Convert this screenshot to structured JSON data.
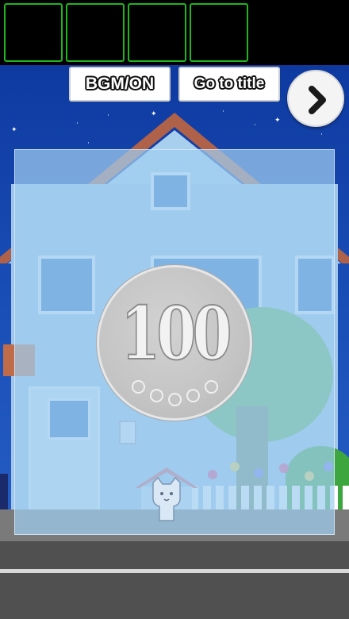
{
  "inventory": {
    "slots": [
      "",
      "",
      "",
      ""
    ],
    "slot_border_color": "#1fb51f"
  },
  "toolbar": {
    "bgm_label": "BGM/ON",
    "title_label": "Go to title",
    "next_icon": "chevron-right-icon"
  },
  "zoom": {
    "item": "100-yen-coin",
    "coin_value": "100"
  },
  "colors": {
    "sky": "#1a4fb8",
    "overlay": "#a0cdf0",
    "coin": "#c4c4c4"
  }
}
